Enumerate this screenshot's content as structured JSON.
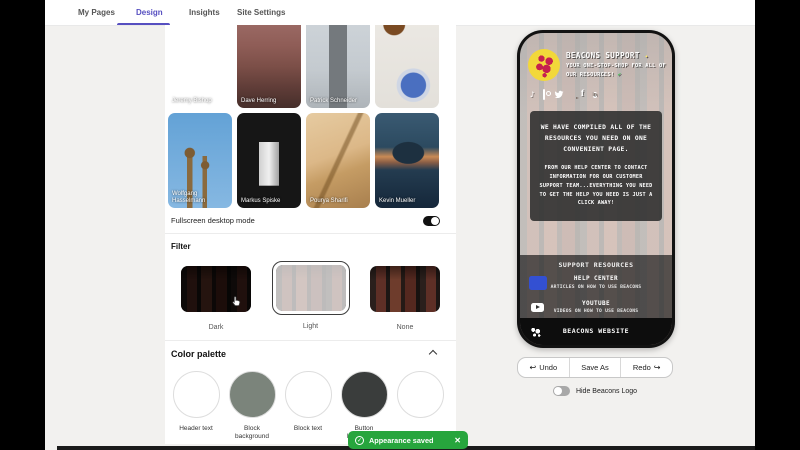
{
  "nav": {
    "items": [
      {
        "label": "My Pages"
      },
      {
        "label": "Design"
      },
      {
        "label": "Insights"
      },
      {
        "label": "Site Settings"
      }
    ]
  },
  "background_grid": {
    "items": [
      {
        "credit": "Jeremy Bishop"
      },
      {
        "credit": "Dave Herring"
      },
      {
        "credit": "Patrick Schneider"
      },
      {
        "credit": ""
      },
      {
        "credit": "Wolfgang Hasselmann"
      },
      {
        "credit": "Markus Spiske"
      },
      {
        "credit": "Pourya Sharifi"
      },
      {
        "credit": "Kevin Mueller"
      }
    ]
  },
  "fullscreen_toggle": {
    "label": "Fullscreen desktop mode",
    "state": "on"
  },
  "filter": {
    "title": "Filter",
    "options": [
      {
        "label": "Dark",
        "selected": false
      },
      {
        "label": "Light",
        "selected": true
      },
      {
        "label": "None",
        "selected": false
      }
    ]
  },
  "color_palette": {
    "title": "Color palette",
    "swatches": [
      {
        "label": "Header text",
        "color": "#ffffff"
      },
      {
        "label": "Block background",
        "color": "#7b847b"
      },
      {
        "label": "Block text",
        "color": "#ffffff"
      },
      {
        "label": "Button background",
        "color": "#3a3d3c"
      },
      {
        "label": "",
        "color": "#ffffff"
      }
    ]
  },
  "preview": {
    "title": "BEACONS SUPPORT",
    "title_emoji": "✦",
    "subtitle": "YOUR ONE-STOP-SHOP FOR ALL OF OUR RESOURCES!",
    "subtitle_emoji": "✔",
    "social_icons": [
      "tiktok",
      "instagram",
      "twitter",
      "youtube",
      "facebook",
      "linkedin"
    ],
    "info_heading": "WE HAVE COMPILED ALL OF THE RESOURCES YOU NEED ON ONE CONVENIENT PAGE.",
    "info_body": "FROM OUR HELP CENTER TO CONTACT INFORMATION FOR OUR CUSTOMER SUPPORT TEAM...EVERYTHING YOU NEED TO GET THE HELP YOU NEED IS JUST A CLICK AWAY!",
    "resources_heading": "SUPPORT RESOURCES",
    "links": [
      {
        "title": "HELP CENTER",
        "subtitle": "ARTICLES ON HOW TO USE BEACONS"
      },
      {
        "title": "YOUTUBE",
        "subtitle": "VIDEOS ON HOW TO USE BEACONS"
      }
    ],
    "footer": "BEACONS WEBSITE"
  },
  "actions": {
    "undo": "Undo",
    "undo_icon": "↩",
    "save_as": "Save As",
    "redo": "Redo",
    "redo_icon": "↪"
  },
  "hide_logo_toggle": {
    "label": "Hide Beacons Logo",
    "state": "off"
  },
  "toast": {
    "check": "✓",
    "message": "Appearance saved",
    "close": "✕"
  },
  "colors": {
    "accent": "#564fc0",
    "toast_green": "#27a53d",
    "help_icon_blue": "#3350d2",
    "avatar_yellow": "#f2d83a"
  }
}
